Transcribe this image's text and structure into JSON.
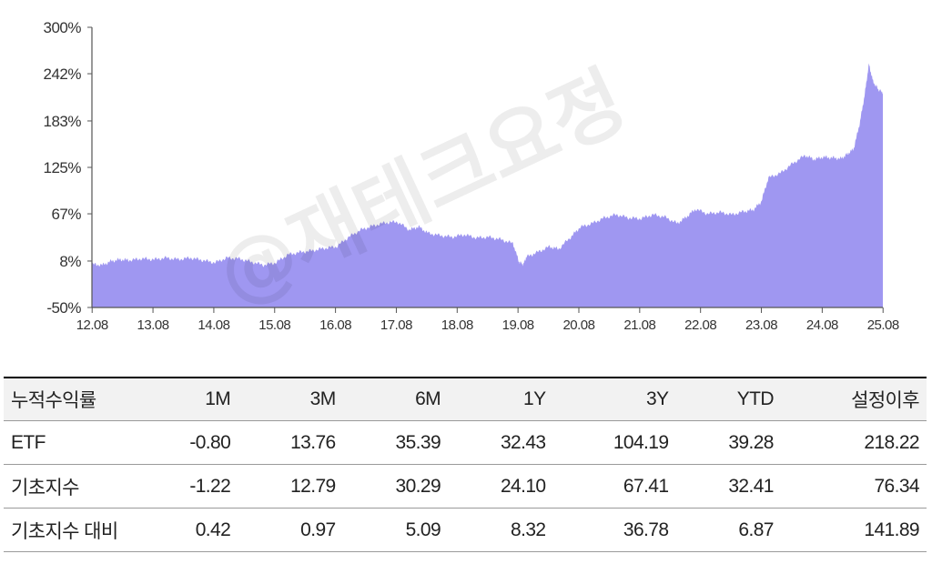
{
  "chart_data": {
    "type": "area",
    "title": "",
    "xlabel": "",
    "ylabel": "",
    "y_ticks": [
      "300%",
      "242%",
      "183%",
      "125%",
      "67%",
      "8%",
      "-50%"
    ],
    "y_tick_values": [
      300,
      242,
      183,
      125,
      67,
      8,
      -50
    ],
    "ylim": [
      -50,
      300
    ],
    "x_ticks": [
      "12.08",
      "13.08",
      "14.08",
      "15.08",
      "16.08",
      "17.08",
      "18.08",
      "19.08",
      "20.08",
      "21.08",
      "22.08",
      "23.08",
      "24.08",
      "25.08"
    ],
    "xlim": [
      2012.58,
      2025.58
    ],
    "color": "#9f97f1",
    "series": [
      {
        "x": [
          2012.58,
          2012.75,
          2012.9,
          2013.05,
          2013.2,
          2013.4,
          2013.6,
          2013.8,
          2014.0,
          2014.2,
          2014.4,
          2014.6,
          2014.8,
          2015.0,
          2015.2,
          2015.4,
          2015.6,
          2015.8,
          2016.0,
          2016.2,
          2016.4,
          2016.6,
          2016.8,
          2017.0,
          2017.2,
          2017.4,
          2017.6,
          2017.8,
          2017.95,
          2018.1,
          2018.3,
          2018.5,
          2018.7,
          2018.9,
          2019.1,
          2019.3,
          2019.5,
          2019.6,
          2019.67,
          2019.72,
          2019.9,
          2020.1,
          2020.25,
          2020.45,
          2020.6,
          2020.8,
          2021.0,
          2021.2,
          2021.4,
          2021.6,
          2021.8,
          2022.0,
          2022.2,
          2022.35,
          2022.5,
          2022.7,
          2022.9,
          2023.1,
          2023.3,
          2023.45,
          2023.58,
          2023.7,
          2023.9,
          2024.1,
          2024.3,
          2024.45,
          2024.6,
          2024.75,
          2024.9,
          2025.0,
          2025.1,
          2025.2,
          2025.28,
          2025.35,
          2025.42,
          2025.5,
          2025.58
        ],
        "values": [
          4,
          3,
          8,
          10,
          9,
          11,
          10,
          12,
          10,
          12,
          9,
          6,
          12,
          11,
          7,
          3,
          6,
          16,
          19,
          21,
          24,
          26,
          38,
          47,
          52,
          56,
          57,
          47,
          51,
          43,
          40,
          38,
          41,
          37,
          38,
          35,
          30,
          7,
          4,
          13,
          19,
          26,
          23,
          38,
          50,
          55,
          62,
          66,
          62,
          61,
          66,
          63,
          55,
          63,
          73,
          67,
          69,
          66,
          70,
          72,
          82,
          112,
          118,
          130,
          140,
          135,
          138,
          137,
          136,
          142,
          148,
          180,
          215,
          254,
          232,
          223,
          218
        ]
      }
    ]
  },
  "table": {
    "columns": [
      "누적수익률",
      "1M",
      "3M",
      "6M",
      "1Y",
      "3Y",
      "YTD",
      "설정이후"
    ],
    "rows": [
      {
        "name": "ETF",
        "values": [
          "-0.80",
          "13.76",
          "35.39",
          "32.43",
          "104.19",
          "39.28",
          "218.22"
        ]
      },
      {
        "name": "기초지수",
        "values": [
          "-1.22",
          "12.79",
          "30.29",
          "24.10",
          "67.41",
          "32.41",
          "76.34"
        ]
      },
      {
        "name": "기초지수 대비",
        "values": [
          "0.42",
          "0.97",
          "5.09",
          "8.32",
          "36.78",
          "6.87",
          "141.89"
        ]
      }
    ]
  },
  "watermark": "@재테크요정"
}
